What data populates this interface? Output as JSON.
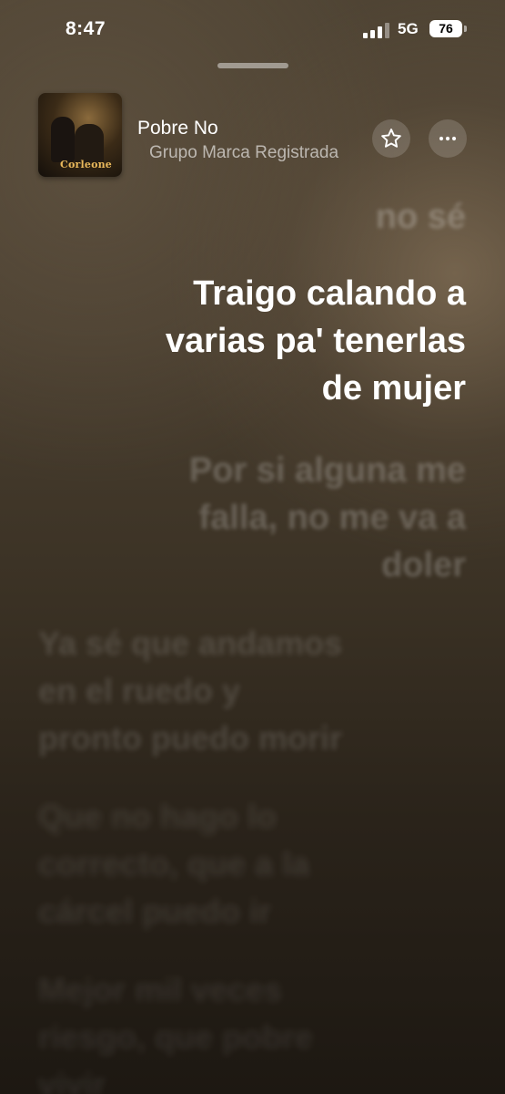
{
  "status_bar": {
    "time": "8:47",
    "network": "5G",
    "battery": "76"
  },
  "now_playing": {
    "title": "Pobre No",
    "artist": "Grupo Marca Registrada",
    "artwork_text": "Corleone",
    "favorite_icon": "star-icon",
    "more_icon": "ellipsis-icon"
  },
  "lyrics": {
    "previous": "no sé",
    "current": "Traigo calando a\nvarias pa' tenerlas\nde mujer",
    "next": "Por si alguna me\nfalla, no me va a\ndoler",
    "line4": "Ya sé que andamos\nen el ruedo y\npronto puedo morir",
    "line5": "Que no hago lo\ncorrecto, que a la\ncárcel puedo ir",
    "line6": "Mejor mil veces\nriesgo, que pobre\nvivir"
  },
  "colors": {
    "background_top": "#4f4434",
    "background_bottom": "#1d1812",
    "active_lyric": "#ffffff"
  }
}
